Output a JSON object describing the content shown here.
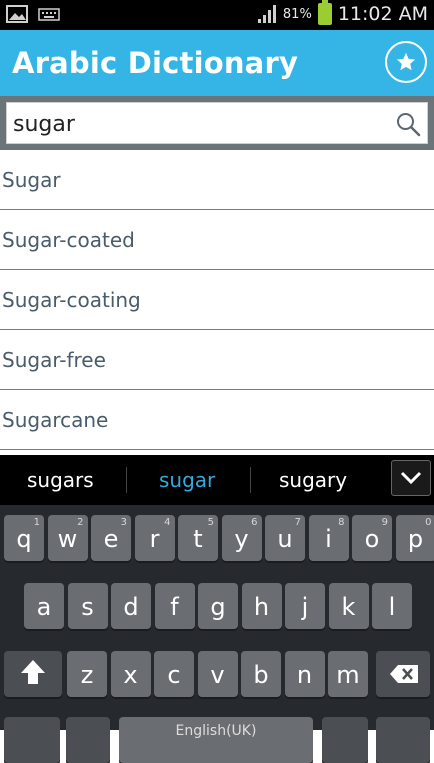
{
  "status": {
    "battery": "81%",
    "time": "11:02 AM"
  },
  "appbar": {
    "title": "Arabic Dictionary"
  },
  "search": {
    "value": "sugar"
  },
  "results": [
    "Sugar",
    "Sugar-coated",
    "Sugar-coating",
    "Sugar-free",
    "Sugarcane"
  ],
  "keyboard": {
    "suggestions": [
      "sugars",
      "sugar",
      "sugary"
    ],
    "row1": [
      [
        "q",
        "1"
      ],
      [
        "w",
        "2"
      ],
      [
        "e",
        "3"
      ],
      [
        "r",
        "4"
      ],
      [
        "t",
        "5"
      ],
      [
        "y",
        "6"
      ],
      [
        "u",
        "7"
      ],
      [
        "i",
        "8"
      ],
      [
        "o",
        "9"
      ],
      [
        "p",
        "0"
      ]
    ],
    "row2": [
      "a",
      "s",
      "d",
      "f",
      "g",
      "h",
      "j",
      "k",
      "l"
    ],
    "row3": [
      "z",
      "x",
      "c",
      "v",
      "b",
      "n",
      "m"
    ],
    "space_label": "English(UK)"
  },
  "colors": {
    "appbar": "#34b5e5",
    "suggestion_active": "#33aadf"
  }
}
